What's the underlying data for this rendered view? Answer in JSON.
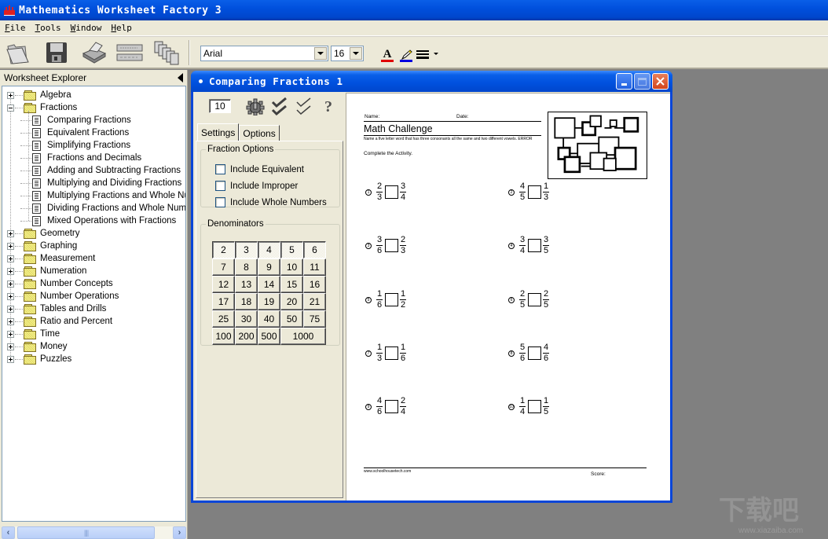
{
  "app": {
    "title": "Mathematics Worksheet Factory 3"
  },
  "menu": [
    "File",
    "Tools",
    "Window",
    "Help"
  ],
  "toolbar": {
    "buttons": [
      {
        "icon": "open-folder-icon",
        "label": "Open"
      },
      {
        "icon": "floppy-disk-icon",
        "label": "Save"
      },
      {
        "icon": "printer-icon",
        "label": "Print"
      },
      {
        "icon": "answer-key-icon",
        "label": "Answer Key"
      },
      {
        "icon": "multiple-pages-icon",
        "label": "Multiple Worksheets"
      }
    ],
    "font_family": "Arial",
    "font_size": "16",
    "text_color": "#e00000",
    "highlight_color": "#0000e0"
  },
  "explorer": {
    "title": "Worksheet Explorer",
    "tree": [
      {
        "label": "Algebra",
        "type": "folder",
        "expanded": false
      },
      {
        "label": "Fractions",
        "type": "folder",
        "expanded": true,
        "children": [
          "Comparing Fractions",
          "Equivalent Fractions",
          "Simplifying Fractions",
          "Fractions and Decimals",
          "Adding and Subtracting Fractions",
          "Multiplying and Dividing Fractions",
          "Multiplying Fractions and Whole Nur",
          "Dividing Fractions and Whole Numb",
          "Mixed Operations with Fractions"
        ]
      },
      {
        "label": "Geometry",
        "type": "folder",
        "expanded": false
      },
      {
        "label": "Graphing",
        "type": "folder",
        "expanded": false
      },
      {
        "label": "Measurement",
        "type": "folder",
        "expanded": false
      },
      {
        "label": "Numeration",
        "type": "folder",
        "expanded": false
      },
      {
        "label": "Number Concepts",
        "type": "folder",
        "expanded": false
      },
      {
        "label": "Number Operations",
        "type": "folder",
        "expanded": false
      },
      {
        "label": "Tables and Drills",
        "type": "folder",
        "expanded": false
      },
      {
        "label": "Ratio and Percent",
        "type": "folder",
        "expanded": false
      },
      {
        "label": "Time",
        "type": "folder",
        "expanded": false
      },
      {
        "label": "Money",
        "type": "folder",
        "expanded": false
      },
      {
        "label": "Puzzles",
        "type": "folder",
        "expanded": false
      }
    ]
  },
  "child_window": {
    "title": "Comparing Fractions 1",
    "problem_count": "10",
    "tabs": [
      "Settings",
      "Options"
    ],
    "active_tab": "Settings",
    "fraction_options": {
      "legend": "Fraction Options",
      "items": [
        {
          "label": "Include Equivalent",
          "checked": false
        },
        {
          "label": "Include Improper",
          "checked": false
        },
        {
          "label": "Include Whole Numbers",
          "checked": false
        }
      ]
    },
    "denominators": {
      "legend": "Denominators",
      "rows": [
        [
          {
            "v": "2",
            "on": true
          },
          {
            "v": "3",
            "on": true
          },
          {
            "v": "4",
            "on": true
          },
          {
            "v": "5",
            "on": true
          },
          {
            "v": "6",
            "on": true
          }
        ],
        [
          {
            "v": "7",
            "on": false
          },
          {
            "v": "8",
            "on": false
          },
          {
            "v": "9",
            "on": false
          },
          {
            "v": "10",
            "on": false
          },
          {
            "v": "11",
            "on": false
          }
        ],
        [
          {
            "v": "12",
            "on": false
          },
          {
            "v": "13",
            "on": false
          },
          {
            "v": "14",
            "on": false
          },
          {
            "v": "15",
            "on": false
          },
          {
            "v": "16",
            "on": false
          }
        ],
        [
          {
            "v": "17",
            "on": false
          },
          {
            "v": "18",
            "on": false
          },
          {
            "v": "19",
            "on": false
          },
          {
            "v": "20",
            "on": false
          },
          {
            "v": "21",
            "on": false
          }
        ],
        [
          {
            "v": "25",
            "on": false
          },
          {
            "v": "30",
            "on": false
          },
          {
            "v": "40",
            "on": false
          },
          {
            "v": "50",
            "on": false
          },
          {
            "v": "75",
            "on": false
          }
        ],
        [
          {
            "v": "100",
            "on": false
          },
          {
            "v": "200",
            "on": false
          },
          {
            "v": "500",
            "on": false
          },
          {
            "v": "1000",
            "on": false
          }
        ]
      ]
    }
  },
  "worksheet": {
    "name_label": "Name:",
    "date_label": "Date:",
    "heading": "Math Challenge",
    "challenge_text": "Name a five letter word that has three consonants all the same and two different vowels. ERROR",
    "instructions": "Complete the Activity.",
    "problems": [
      {
        "n": "1",
        "a": [
          "2",
          "3"
        ],
        "b": [
          "3",
          "4"
        ]
      },
      {
        "n": "2",
        "a": [
          "4",
          "5"
        ],
        "b": [
          "1",
          "3"
        ]
      },
      {
        "n": "3",
        "a": [
          "3",
          "6"
        ],
        "b": [
          "2",
          "3"
        ]
      },
      {
        "n": "4",
        "a": [
          "3",
          "4"
        ],
        "b": [
          "3",
          "5"
        ]
      },
      {
        "n": "5",
        "a": [
          "1",
          "6"
        ],
        "b": [
          "1",
          "2"
        ]
      },
      {
        "n": "6",
        "a": [
          "2",
          "5"
        ],
        "b": [
          "2",
          "5"
        ]
      },
      {
        "n": "7",
        "a": [
          "1",
          "3"
        ],
        "b": [
          "1",
          "6"
        ]
      },
      {
        "n": "8",
        "a": [
          "5",
          "6"
        ],
        "b": [
          "4",
          "6"
        ]
      },
      {
        "n": "9",
        "a": [
          "4",
          "6"
        ],
        "b": [
          "2",
          "4"
        ]
      },
      {
        "n": "10",
        "a": [
          "1",
          "4"
        ],
        "b": [
          "1",
          "5"
        ]
      }
    ],
    "footer_url": "www.schoolhousetech.com",
    "score_label": "Score:"
  },
  "watermark": {
    "text": "下载吧",
    "url": "www.xiazaiba.com"
  }
}
